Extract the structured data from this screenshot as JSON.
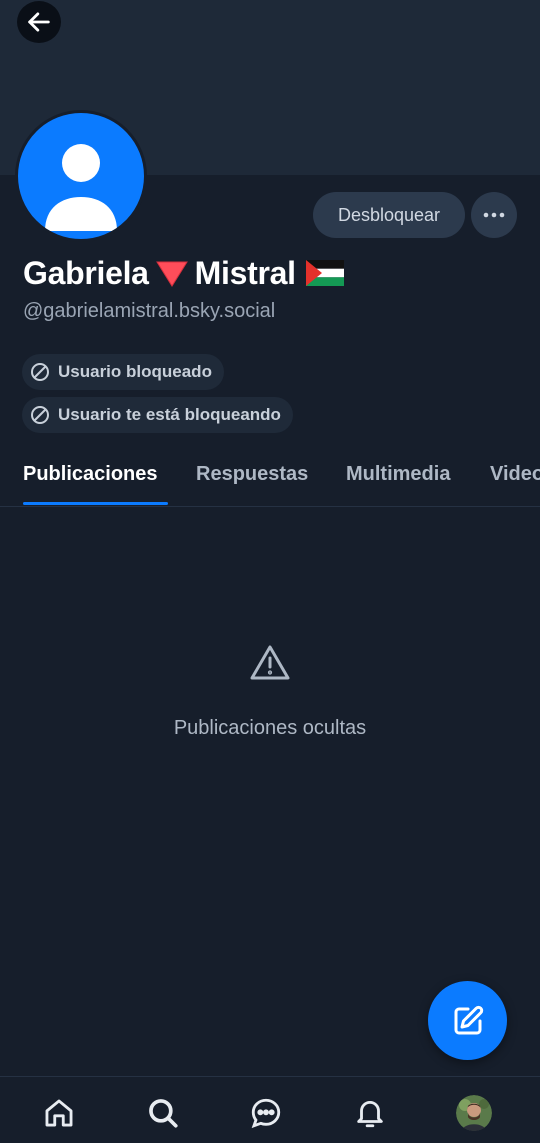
{
  "header": {
    "back_icon": "arrow-left-icon"
  },
  "profile": {
    "display_name_part1": "Gabriela",
    "display_name_part2": "Mistral",
    "name_emoji": "red-triangle-down",
    "flag_emoji": "palestine-flag",
    "handle": "@gabrielamistral.bsky.social",
    "avatar_icon": "default-user-avatar"
  },
  "actions": {
    "unblock_label": "Desbloquear",
    "more_icon": "ellipsis-icon"
  },
  "badges": [
    {
      "icon": "block-icon",
      "label": "Usuario bloqueado"
    },
    {
      "icon": "block-icon",
      "label": "Usuario te está bloqueando"
    }
  ],
  "tabs": [
    {
      "label": "Publicaciones",
      "active": true
    },
    {
      "label": "Respuestas",
      "active": false
    },
    {
      "label": "Multimedia",
      "active": false
    },
    {
      "label": "Video",
      "active": false
    }
  ],
  "empty_state": {
    "icon": "warning-icon",
    "message": "Publicaciones ocultas"
  },
  "fab": {
    "icon": "compose-icon"
  },
  "bottom_nav": {
    "items": [
      "home-icon",
      "search-icon",
      "chat-icon",
      "bell-icon",
      "profile-avatar"
    ]
  },
  "colors": {
    "background": "#161e2b",
    "banner": "#1e2938",
    "accent": "#0b7bff",
    "button_bg": "#2c3a4d",
    "muted_text": "#9aa5b4"
  }
}
